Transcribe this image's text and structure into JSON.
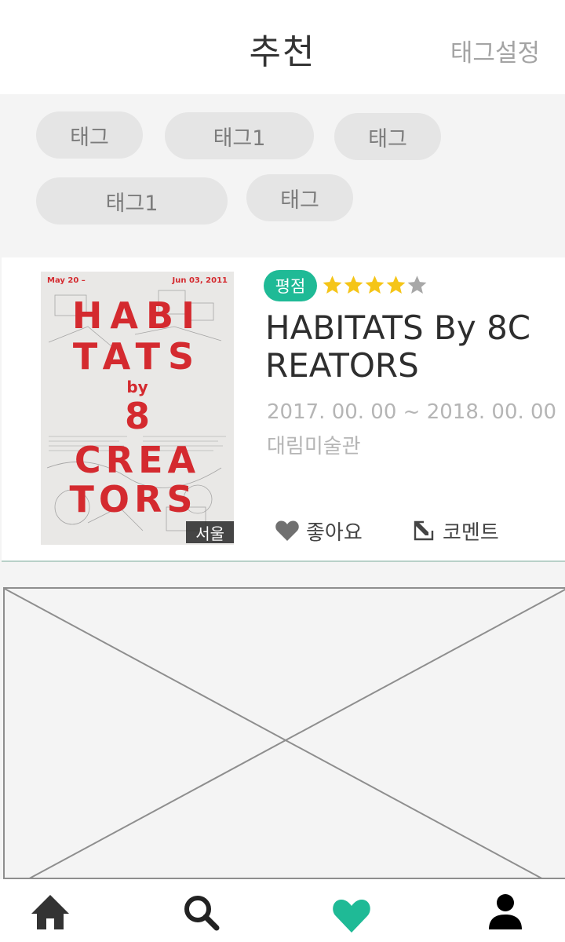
{
  "header": {
    "title": "추천",
    "action_label": "태그설정"
  },
  "tags": [
    {
      "label": "태그"
    },
    {
      "label": "태그1"
    },
    {
      "label": "태그"
    },
    {
      "label": "태그1"
    },
    {
      "label": "태그"
    }
  ],
  "card": {
    "poster": {
      "top_left": "May 20 –",
      "top_right": "Jun 03, 2011",
      "lines": [
        "HABI",
        "TATS",
        "by",
        "8",
        "CREA",
        "TORS"
      ],
      "region": "서울"
    },
    "rating_label": "평점",
    "rating": 4,
    "rating_max": 5,
    "title": "HABITATS By 8CREATORS",
    "dates": "2017. 00. 00 ~ 2018. 00. 00",
    "venue": "대림미술관",
    "like_label": "좋아요",
    "comment_label": "코멘트"
  },
  "bottom_nav": [
    {
      "icon": "home-icon"
    },
    {
      "icon": "search-icon"
    },
    {
      "icon": "heart-icon",
      "active": true
    },
    {
      "icon": "user-icon"
    }
  ],
  "colors": {
    "accent": "#1fba96",
    "star_filled": "#f5c518",
    "star_empty": "#a8a8a8",
    "poster_red": "#d42a2f"
  }
}
